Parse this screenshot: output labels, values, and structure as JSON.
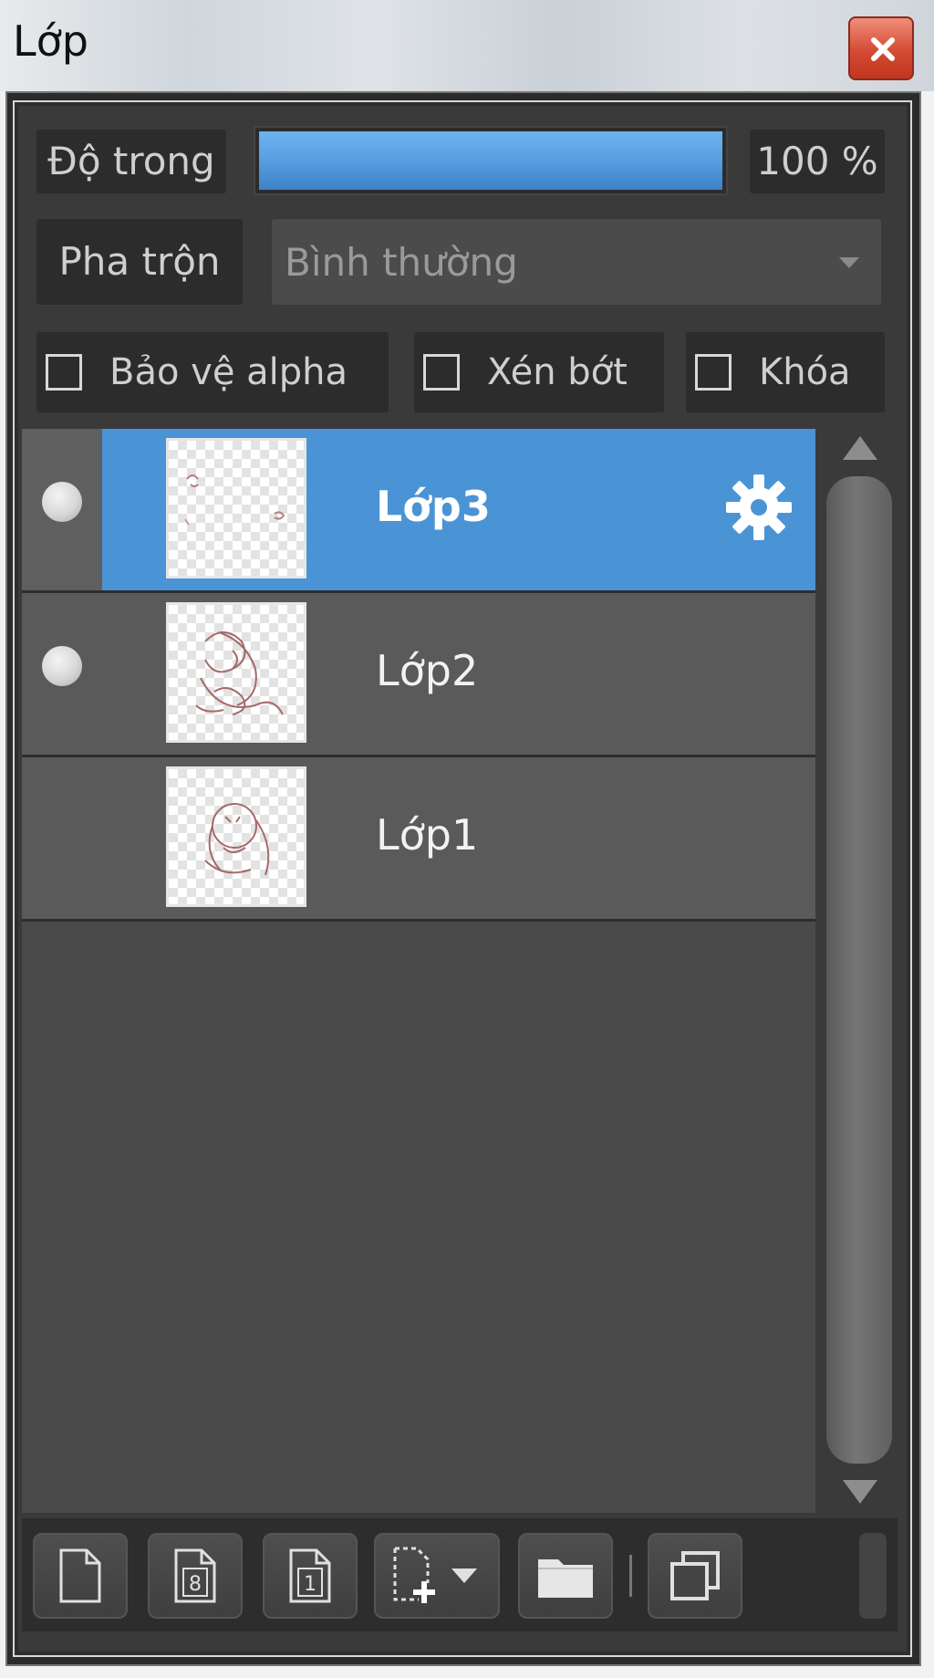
{
  "window": {
    "title": "Lớp",
    "close_icon": "close-icon"
  },
  "opacity": {
    "label": "Độ trong",
    "value_text": "100 %",
    "value": 100
  },
  "blend": {
    "label": "Pha trộn",
    "selected": "Bình thường"
  },
  "options": {
    "protect_alpha": {
      "label": "Bảo vệ alpha",
      "checked": false
    },
    "clipping": {
      "label": "Xén bớt",
      "checked": false
    },
    "lock": {
      "label": "Khóa",
      "checked": false
    }
  },
  "layers": [
    {
      "name": "Lớp3",
      "selected": true,
      "visible_dot": true,
      "settings_icon": "gear-icon"
    },
    {
      "name": "Lớp2",
      "selected": false,
      "visible_dot": true
    },
    {
      "name": "Lớp1",
      "selected": false,
      "visible_dot": false
    }
  ],
  "toolbar": {
    "buttons": [
      {
        "icon": "new-layer-icon"
      },
      {
        "icon": "new-8bit-layer-icon",
        "glyph": "8"
      },
      {
        "icon": "new-1bit-layer-icon",
        "glyph": "1"
      },
      {
        "icon": "add-layer-dropdown-icon"
      },
      {
        "icon": "folder-icon"
      },
      {
        "icon": "duplicate-layer-icon"
      }
    ]
  },
  "colors": {
    "accent": "#4a94d6",
    "panel_bg": "#3a3a3a",
    "close_red": "#d44a33"
  }
}
